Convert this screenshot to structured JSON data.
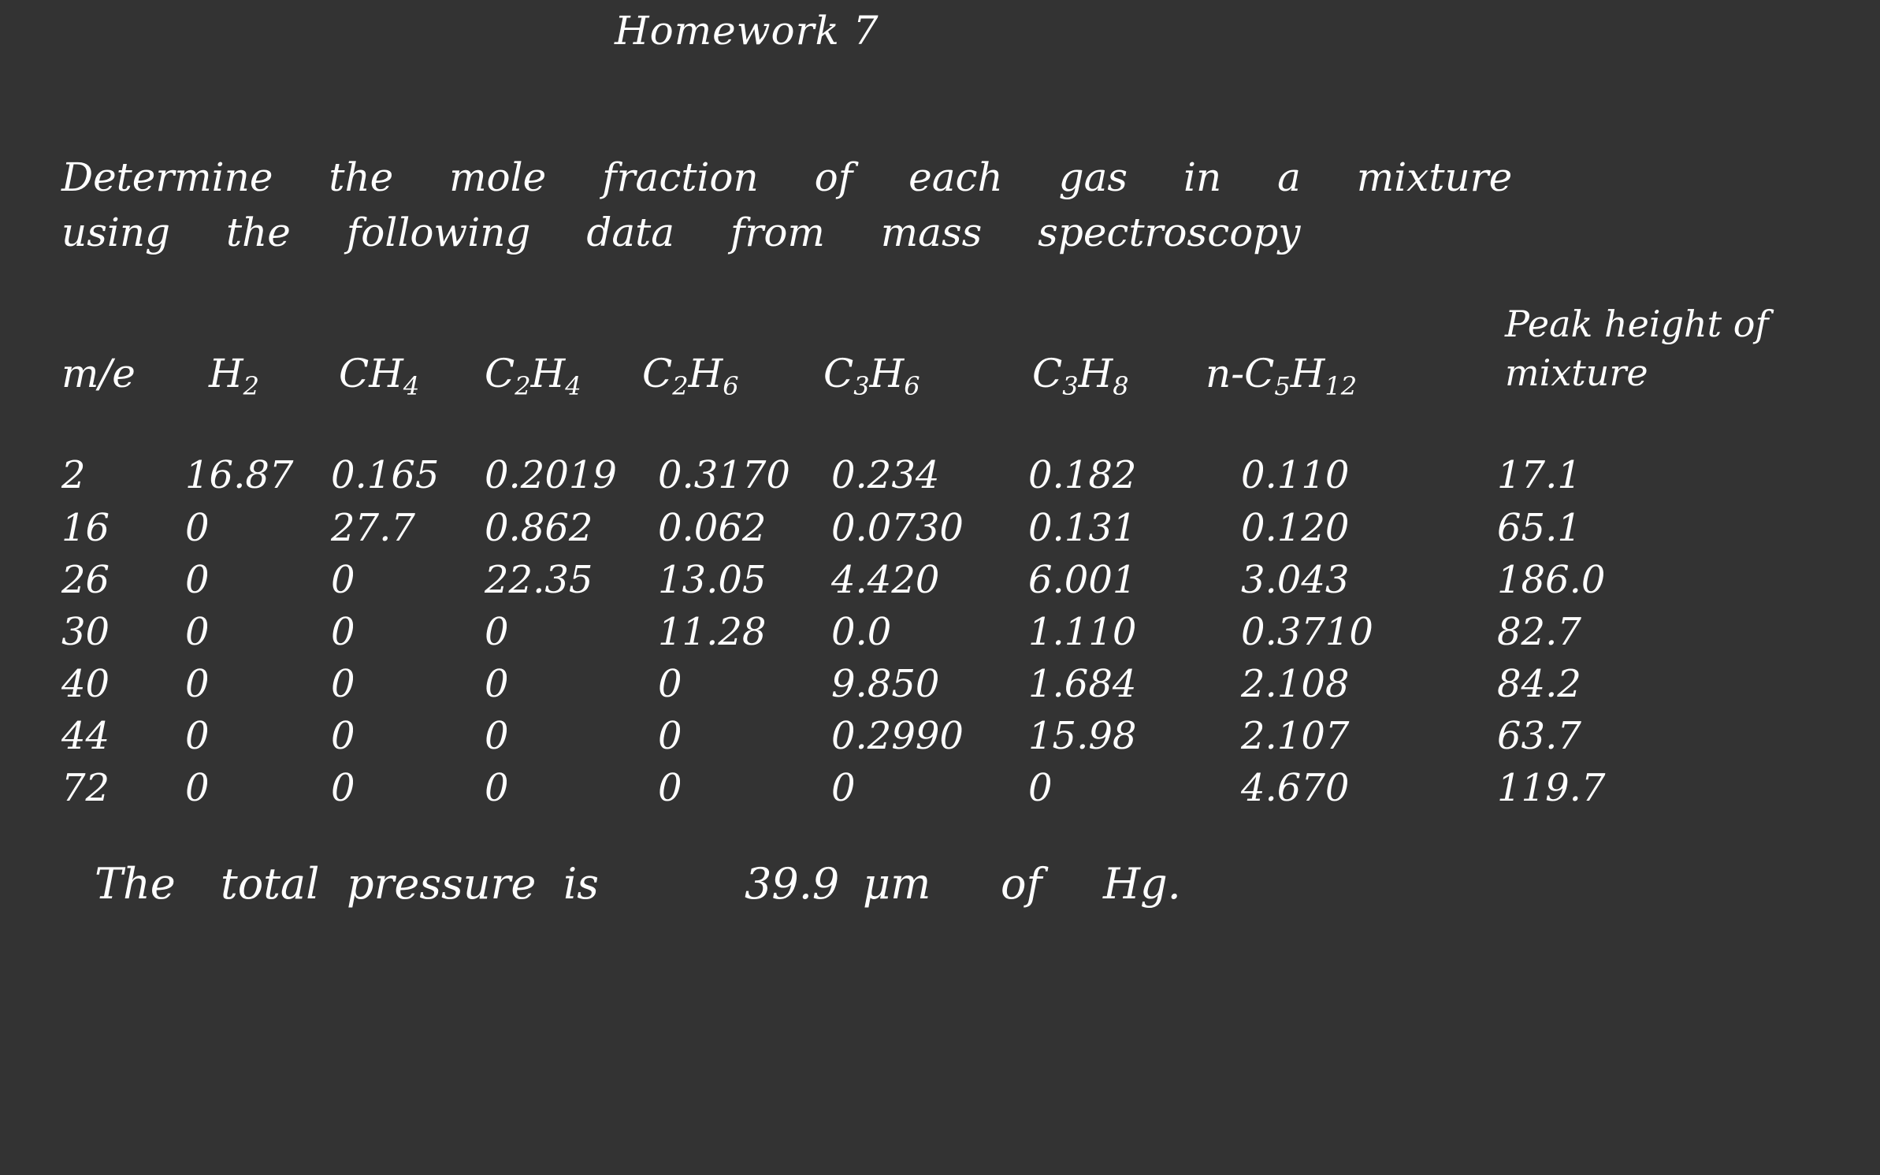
{
  "title": "Homework 7",
  "prompt": {
    "line1": "Determine the mole fraction of each gas in a mixture",
    "line2": "using the following data from mass spectroscopy"
  },
  "table": {
    "headers": [
      {
        "main": "m/e",
        "parts": []
      },
      {
        "main": "",
        "parts": [
          {
            "t": "H",
            "s": "2"
          }
        ]
      },
      {
        "main": "",
        "parts": [
          {
            "t": "CH",
            "s": "4"
          }
        ]
      },
      {
        "main": "",
        "parts": [
          {
            "t": "C",
            "s": "2"
          },
          {
            "t": "H",
            "s": "4"
          }
        ]
      },
      {
        "main": "",
        "parts": [
          {
            "t": "C",
            "s": "2"
          },
          {
            "t": "H",
            "s": "6"
          }
        ]
      },
      {
        "main": "",
        "parts": [
          {
            "t": "C",
            "s": "3"
          },
          {
            "t": "H",
            "s": "6"
          }
        ]
      },
      {
        "main": "",
        "parts": [
          {
            "t": "C",
            "s": "3"
          },
          {
            "t": "H",
            "s": "8"
          }
        ]
      },
      {
        "main": "",
        "parts": [
          {
            "t": "n-C",
            "s": "5"
          },
          {
            "t": "H",
            "s": "12"
          }
        ]
      },
      {
        "main": "Peak height of mixture",
        "parts": []
      }
    ],
    "rows": [
      [
        "2",
        "16.87",
        "0.165",
        "0.2019",
        "0.3170",
        "0.234",
        "0.182",
        "0.110",
        "17.1"
      ],
      [
        "16",
        "0",
        "27.7",
        "0.862",
        "0.062",
        "0.0730",
        "0.131",
        "0.120",
        "65.1"
      ],
      [
        "26",
        "0",
        "0",
        "22.35",
        "13.05",
        "4.420",
        "6.001",
        "3.043",
        "186.0"
      ],
      [
        "30",
        "0",
        "0",
        "0",
        "11.28",
        "0.0",
        "1.110",
        "0.3710",
        "82.7"
      ],
      [
        "40",
        "0",
        "0",
        "0",
        "0",
        "9.850",
        "1.684",
        "2.108",
        "84.2"
      ],
      [
        "44",
        "0",
        "0",
        "0",
        "0",
        "0.2990",
        "15.98",
        "2.107",
        "63.7"
      ],
      [
        "72",
        "0",
        "0",
        "0",
        "0",
        "0",
        "0",
        "4.670",
        "119.7"
      ]
    ]
  },
  "footer": {
    "w1": "The",
    "w2": "total",
    "w3": "pressure",
    "w4": "is",
    "value": "39.9",
    "unit": "μm",
    "w5": "of",
    "w6": "Hg."
  }
}
